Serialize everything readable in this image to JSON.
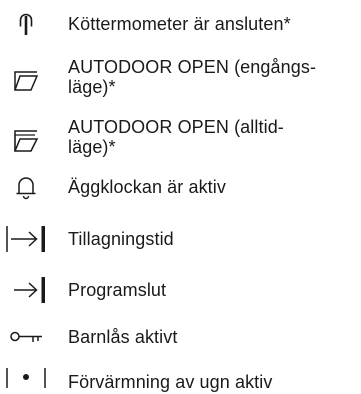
{
  "legend": {
    "items": [
      {
        "icon": "meat-probe-icon",
        "label": "Köttermometer är ansluten*"
      },
      {
        "icon": "autodoor-open-single-icon",
        "label": "AUTODOOR OPEN (engångs-\nläge)*"
      },
      {
        "icon": "autodoor-open-always-icon",
        "label": "AUTODOOR OPEN (alltid-\nläge)*"
      },
      {
        "icon": "bell-icon",
        "label": "Äggklockan är aktiv"
      },
      {
        "icon": "cooking-time-icon",
        "label": "Tillagningstid"
      },
      {
        "icon": "program-end-icon",
        "label": "Programslut"
      },
      {
        "icon": "key-icon",
        "label": "Barnlås aktivt"
      },
      {
        "icon": "preheat-icon",
        "label": "Förvärmning av ugn aktiv"
      }
    ]
  }
}
